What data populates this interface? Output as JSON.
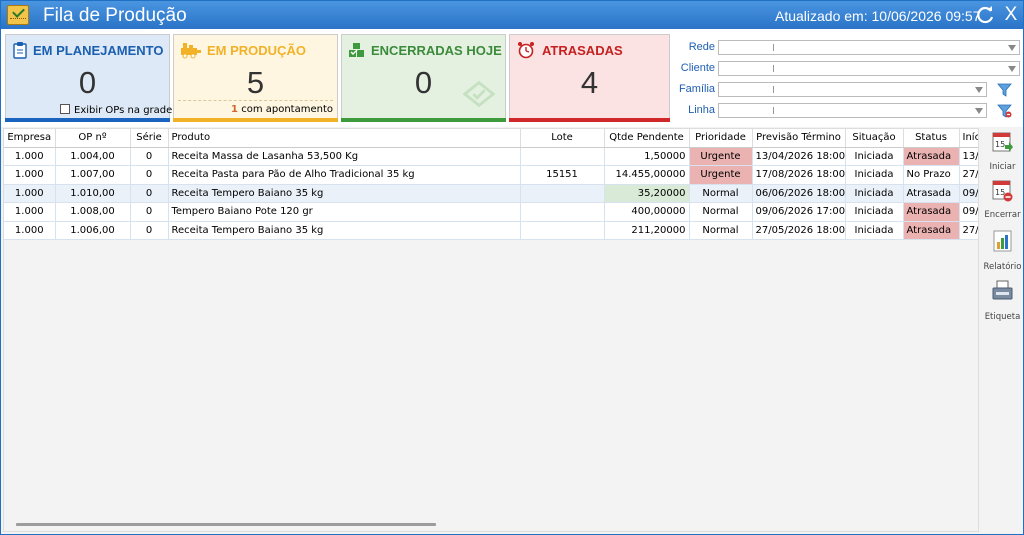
{
  "titlebar": {
    "title": "Fila de Produção",
    "updated": "Atualizado em: 10/06/2026 09:57",
    "close_label": "X"
  },
  "cards": {
    "planning": {
      "title": "EM PLANEJAMENTO",
      "value": "0",
      "checkbox_label": "Exibir OPs na grade"
    },
    "production": {
      "title": "EM PRODUÇÃO",
      "value": "5",
      "sub_count": "1",
      "sub_label": "com apontamento"
    },
    "closed": {
      "title": "ENCERRADAS HOJE",
      "value": "0"
    },
    "late": {
      "title": "ATRASADAS",
      "value": "4"
    }
  },
  "filters": {
    "rede": {
      "label": "Rede",
      "value": ""
    },
    "cliente": {
      "label": "Cliente",
      "value": ""
    },
    "familia": {
      "label": "Família",
      "value": ""
    },
    "linha": {
      "label": "Linha",
      "value": ""
    }
  },
  "grid": {
    "columns": [
      "Empresa",
      "OP nº",
      "Série",
      "Produto",
      "Lote",
      "Qtde Pendente",
      "Prioridade",
      "Previsão Término",
      "Situação",
      "Status",
      "Início"
    ],
    "rows": [
      {
        "empresa": "1.000",
        "op": "1.004,00",
        "serie": "0",
        "produto": "Receita Massa de Lasanha 53,500 Kg",
        "lote": "",
        "qtde": "1,50000",
        "prioridade": "Urgente",
        "previsao": "13/04/2026 18:00",
        "situacao": "Iniciada",
        "status": "Atrasada",
        "inicio": "13/"
      },
      {
        "empresa": "1.000",
        "op": "1.007,00",
        "serie": "0",
        "produto": "Receita Pasta para Pão de Alho Tradicional 35 kg",
        "lote": "15151",
        "qtde": "14.455,00000",
        "prioridade": "Urgente",
        "previsao": "17/08/2026 18:00",
        "situacao": "Iniciada",
        "status": "No Prazo",
        "inicio": "27/"
      },
      {
        "empresa": "1.000",
        "op": "1.010,00",
        "serie": "0",
        "produto": "Receita Tempero Baiano 35 kg",
        "lote": "",
        "qtde": "35,20000",
        "prioridade": "Normal",
        "previsao": "06/06/2026 18:00",
        "situacao": "Iniciada",
        "status": "Atrasada",
        "inicio": "09/"
      },
      {
        "empresa": "1.000",
        "op": "1.008,00",
        "serie": "0",
        "produto": "Tempero Baiano Pote 120 gr",
        "lote": "",
        "qtde": "400,00000",
        "prioridade": "Normal",
        "previsao": "09/06/2026 17:00",
        "situacao": "Iniciada",
        "status": "Atrasada",
        "inicio": "09/"
      },
      {
        "empresa": "1.000",
        "op": "1.006,00",
        "serie": "0",
        "produto": "Receita Tempero Baiano 35 kg",
        "lote": "",
        "qtde": "211,20000",
        "prioridade": "Normal",
        "previsao": "27/05/2026 18:00",
        "situacao": "Iniciada",
        "status": "Atrasada",
        "inicio": "27/"
      }
    ]
  },
  "sidebar": {
    "start": {
      "label": "Iniciar",
      "icon": "calendar-start-icon"
    },
    "finish": {
      "label": "Encerrar",
      "icon": "calendar-stop-icon"
    },
    "report": {
      "label": "Relatório",
      "icon": "report-chart-icon"
    },
    "tag": {
      "label": "Etiqueta",
      "icon": "label-printer-icon"
    },
    "calendar_day": "15"
  },
  "colors": {
    "title_bar": "#2a73c8",
    "planning": "#1a64c0",
    "production": "#f2b227",
    "closed": "#3d9a3d",
    "late": "#d02828",
    "urgent_cell": "#ebb2b2",
    "selected_row": "#eaf1f8"
  }
}
